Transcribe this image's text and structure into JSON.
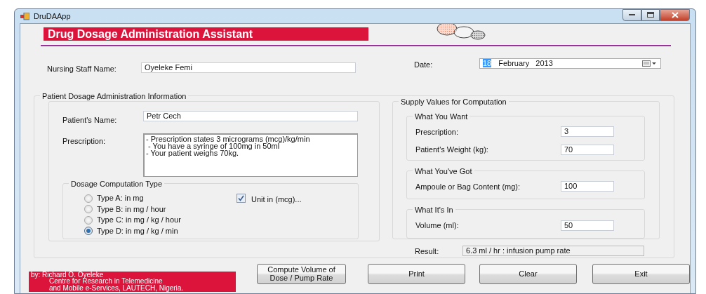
{
  "window": {
    "title": "DruDAApp"
  },
  "banner": {
    "title": "Drug Dosage Administration Assistant"
  },
  "staff": {
    "label": "Nursing Staff Name:",
    "value": "Oyeleke Femi"
  },
  "date": {
    "label": "Date:",
    "day": "18",
    "month": "February",
    "year": "2013"
  },
  "patient_info": {
    "title": "Patient Dosage Administration Information",
    "name": {
      "label": "Patient's Name:",
      "value": "Petr Cech"
    },
    "prescription": {
      "label": "Prescription:",
      "lines": [
        "- Prescription states 3 micrograms (mcg)/kg/min",
        " - You have a syringe of 100mg in 50ml",
        "- Your patient weighs 70kg."
      ]
    },
    "computation": {
      "title": "Dosage Computation Type",
      "options": [
        {
          "label": "Type A: in mg",
          "selected": false
        },
        {
          "label": "Type B: in mg / hour",
          "selected": false
        },
        {
          "label": "Type C: in mg / kg / hour",
          "selected": false
        },
        {
          "label": "Type D: in mg / kg / min",
          "selected": true
        }
      ],
      "unit_checkbox": {
        "label": "Unit in (mcg)...",
        "checked": true
      }
    }
  },
  "supply": {
    "title": "Supply Values for Computation",
    "sections": [
      {
        "title": "What You Want",
        "fields": [
          {
            "label": "Prescription:",
            "value": "3"
          },
          {
            "label": "Patient's Weight (kg):",
            "value": "70"
          }
        ]
      },
      {
        "title": "What You've Got",
        "fields": [
          {
            "label": "Ampoule or Bag Content (mg):",
            "value": "100"
          }
        ]
      },
      {
        "title": "What It's In",
        "fields": [
          {
            "label": "Volume (ml):",
            "value": "50"
          }
        ]
      }
    ]
  },
  "result": {
    "label": "Result:",
    "value": "6.3 ml / hr : infusion pump rate"
  },
  "credits": [
    "by: Richard O. Oyeleke",
    "Centre for Research in Telemedicine",
    "and Mobile e-Services, LAUTECH, Nigeria."
  ],
  "buttons": [
    "Compute Volume of Dose / Pump Rate",
    "Print",
    "Clear",
    "Exit"
  ]
}
